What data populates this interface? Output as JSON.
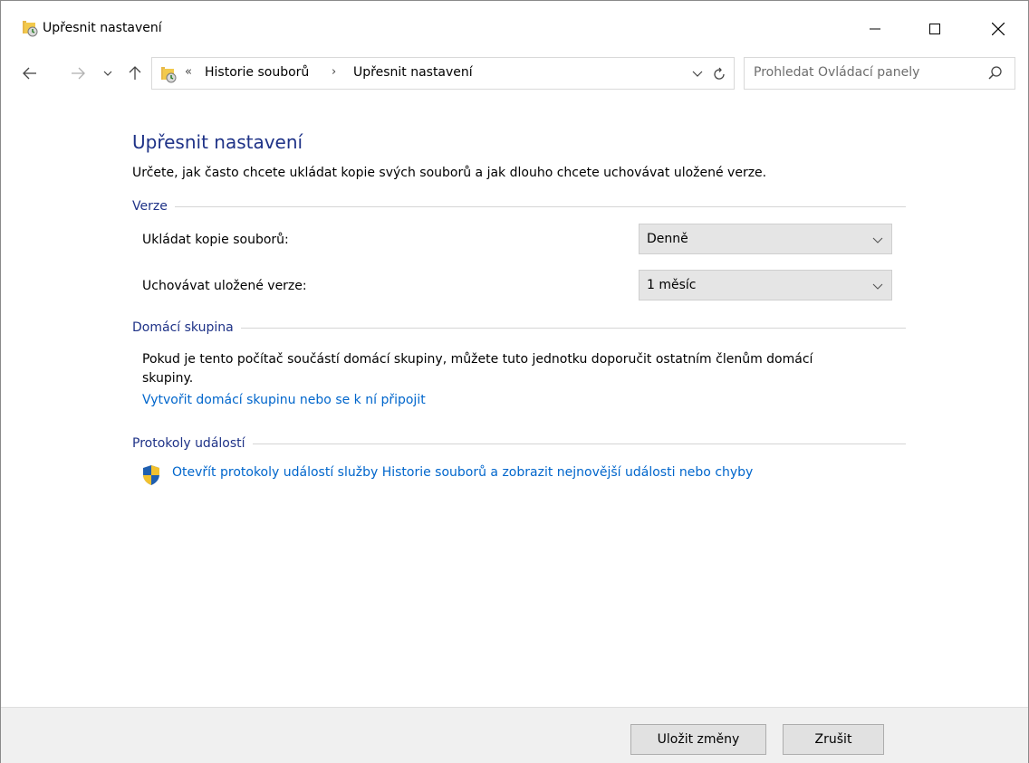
{
  "window": {
    "title": "Upřesnit nastavení"
  },
  "navigation": {
    "breadcrumb_separator": "«",
    "crumbs": [
      "Historie souborů",
      "Upřesnit nastavení"
    ],
    "crumb_arrow": "›",
    "search_placeholder": "Prohledat Ovládací panely"
  },
  "page": {
    "title": "Upřesnit nastavení",
    "description": "Určete, jak často chcete ukládat kopie svých souborů a jak dlouho chcete uchovávat uložené verze."
  },
  "versions": {
    "header": "Verze",
    "save_copies_label": "Ukládat kopie souborů:",
    "save_copies_value": "Denně",
    "keep_versions_label": "Uchovávat uložené verze:",
    "keep_versions_value": "1 měsíc"
  },
  "homegroup": {
    "header": "Domácí skupina",
    "text": "Pokud je tento počítač součástí domácí skupiny, můžete tuto jednotku doporučit ostatním členům domácí skupiny.",
    "link": "Vytvořit domácí skupinu nebo se k ní připojit"
  },
  "event_logs": {
    "header": "Protokoly událostí",
    "link": "Otevřít protokoly událostí služby Historie souborů a zobrazit nejnovější události nebo chyby"
  },
  "footer": {
    "save_label": "Uložit změny",
    "cancel_label": "Zrušit"
  },
  "colors": {
    "heading_blue": "#1e3287",
    "link_blue": "#0066cc",
    "footer_bg": "#f0f0f0"
  },
  "icons": {
    "title": "file-history-icon",
    "back": "arrow-left-icon",
    "forward": "arrow-right-icon",
    "recent": "chevron-down-icon",
    "up": "arrow-up-icon",
    "refresh": "refresh-icon",
    "search": "search-icon",
    "shield": "uac-shield-icon"
  }
}
